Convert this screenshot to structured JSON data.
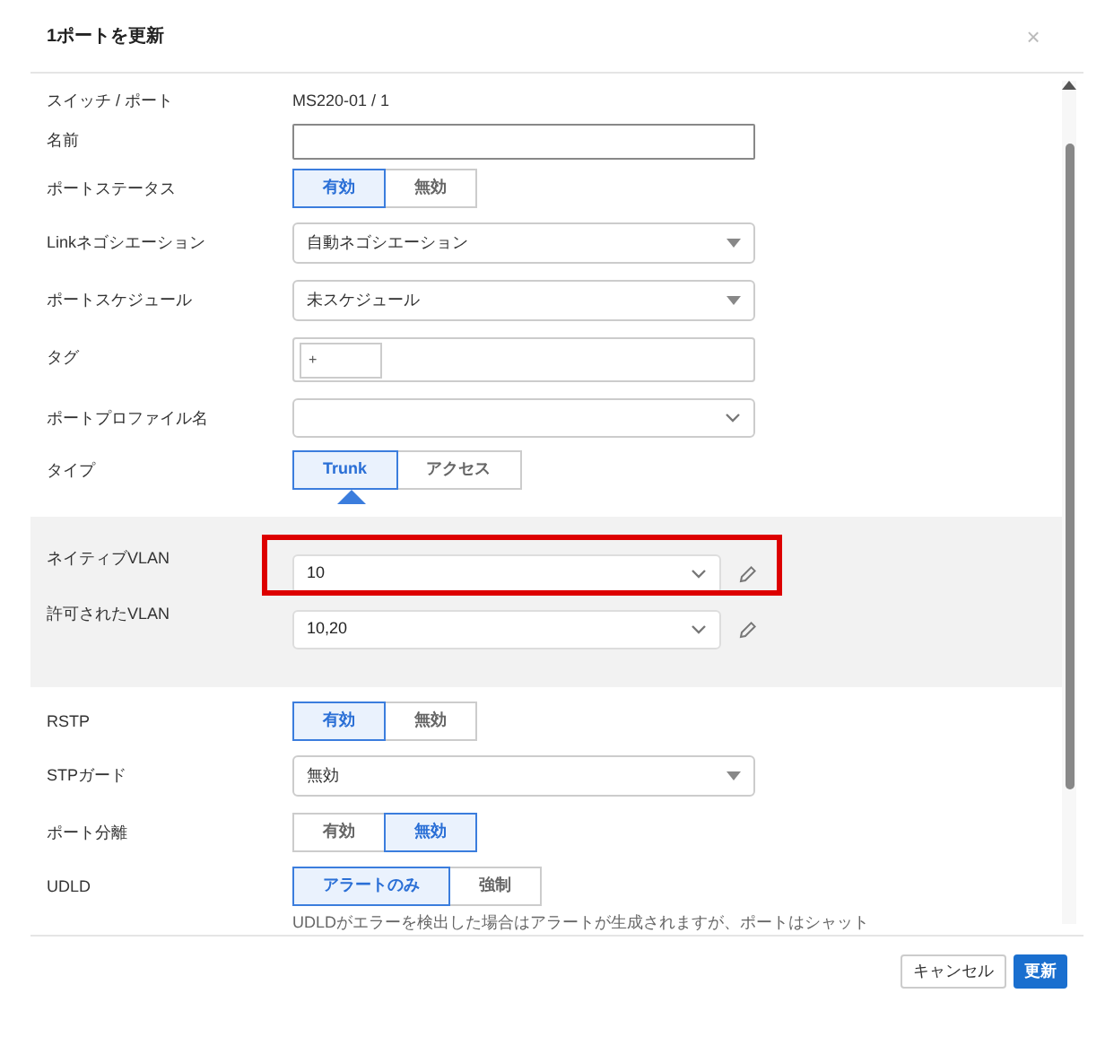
{
  "dialog": {
    "title": "1ポートを更新",
    "close": "×"
  },
  "rows": [
    {
      "kind": "text",
      "label": "スイッチ / ポート",
      "value": "MS220-01 / 1"
    },
    {
      "kind": "input",
      "label": "名前"
    },
    {
      "kind": "toggle",
      "label": "ポートステータス",
      "options": [
        {
          "label": "有効",
          "selected": true
        },
        {
          "label": "無効",
          "selected": false
        }
      ]
    },
    {
      "kind": "select",
      "label": "Linkネゴシエーション",
      "value": "自動ネゴシエーション"
    },
    {
      "kind": "select",
      "label": "ポートスケジュール",
      "value": "未スケジュール"
    },
    {
      "kind": "tags",
      "label": "タグ",
      "add": "+"
    },
    {
      "kind": "combo",
      "label": "ポートプロファイル名"
    },
    {
      "kind": "toggle",
      "label": "タイプ",
      "pointer": true,
      "options": [
        {
          "label": "Trunk",
          "selected": true
        },
        {
          "label": "アクセス",
          "selected": false
        }
      ]
    }
  ],
  "vlan_panel": [
    {
      "label": "ネイティブVLAN",
      "value": "10",
      "highlighted": true
    },
    {
      "label": "許可されたVLAN",
      "value": "10,20",
      "highlighted": false
    }
  ],
  "rows_after": [
    {
      "kind": "toggle",
      "label": "RSTP",
      "options": [
        {
          "label": "有効",
          "selected": true
        },
        {
          "label": "無効",
          "selected": false
        }
      ]
    },
    {
      "kind": "select",
      "label": "STPガード",
      "value": "無効"
    },
    {
      "kind": "toggle",
      "label": "ポート分離",
      "options": [
        {
          "label": "有効",
          "selected": false
        },
        {
          "label": "無効",
          "selected": true
        }
      ]
    },
    {
      "kind": "toggle",
      "label": "UDLD",
      "options": [
        {
          "label": "アラートのみ",
          "selected": true
        },
        {
          "label": "強制",
          "selected": false
        }
      ],
      "note": "UDLDがエラーを検出した場合はアラートが生成されますが、ポートはシャット"
    }
  ],
  "buttons": [
    {
      "label": "キャンセル",
      "primary": false
    },
    {
      "label": "更新",
      "primary": true
    }
  ]
}
